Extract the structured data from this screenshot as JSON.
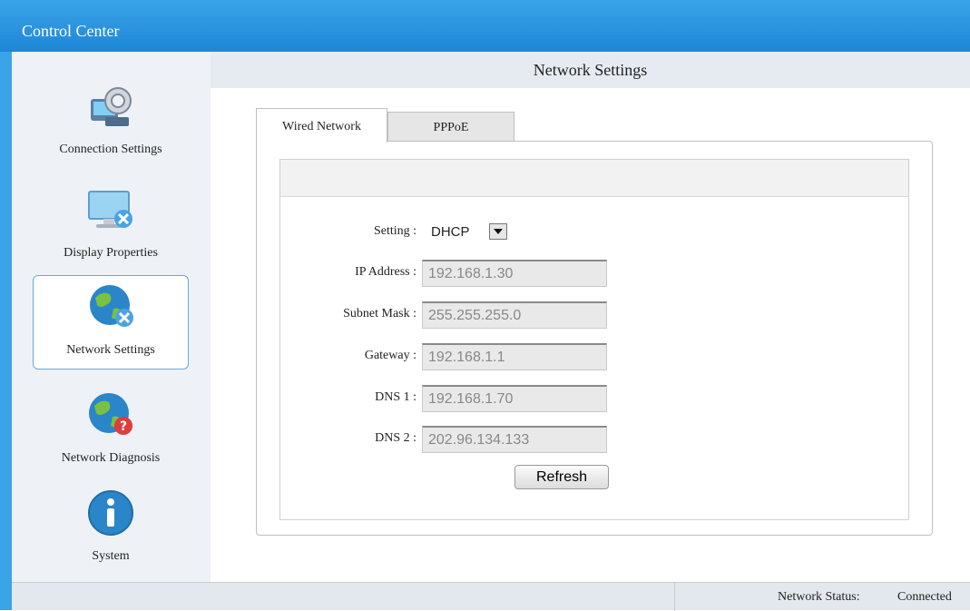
{
  "window": {
    "title": "Control Center"
  },
  "sidebar": {
    "items": [
      {
        "label": "Connection Settings",
        "icon": "connection-settings-icon",
        "active": false
      },
      {
        "label": "Display Properties",
        "icon": "display-properties-icon",
        "active": false
      },
      {
        "label": "Network Settings",
        "icon": "network-settings-icon",
        "active": true
      },
      {
        "label": "Network Diagnosis",
        "icon": "network-diagnosis-icon",
        "active": false
      },
      {
        "label": "System",
        "icon": "info-icon",
        "active": false
      }
    ]
  },
  "main": {
    "title": "Network Settings",
    "tabs": [
      {
        "label": "Wired Network",
        "active": true
      },
      {
        "label": "PPPoE",
        "active": false
      }
    ],
    "form": {
      "setting_label": "Setting :",
      "setting_value": "DHCP",
      "fields": [
        {
          "label": "IP Address :",
          "value": "192.168.1.30"
        },
        {
          "label": "Subnet Mask :",
          "value": "255.255.255.0"
        },
        {
          "label": "Gateway :",
          "value": "192.168.1.1"
        },
        {
          "label": "DNS 1 :",
          "value": "192.168.1.70"
        },
        {
          "label": "DNS 2 :",
          "value": "202.96.134.133"
        }
      ],
      "refresh_label": "Refresh"
    }
  },
  "statusbar": {
    "label": "Network Status:",
    "value": "Connected"
  },
  "colors": {
    "accent": "#1e86d6",
    "sidebar_bg": "#eef2f7",
    "header_bg": "#e6ebf1"
  }
}
